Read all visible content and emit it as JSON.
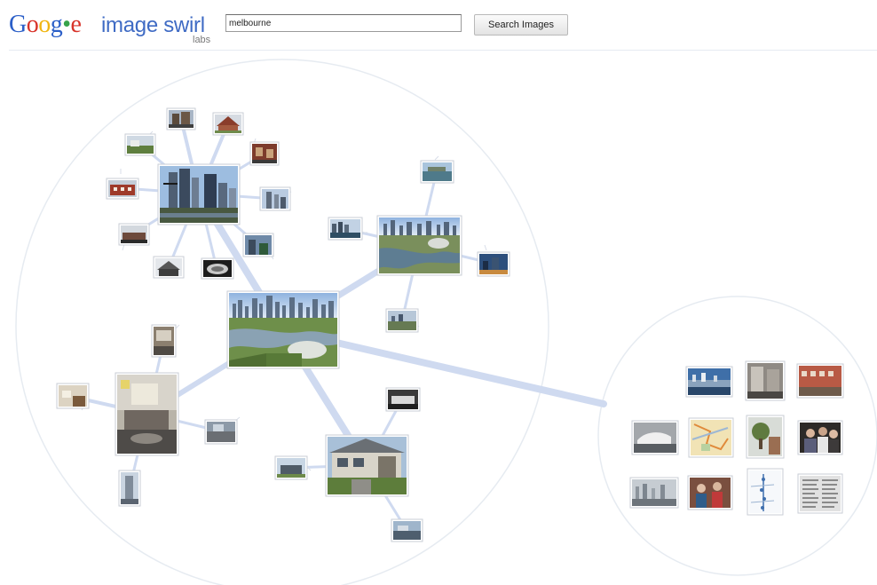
{
  "header": {
    "logo_letters": [
      {
        "ch": "G",
        "color": "#2b5fc8"
      },
      {
        "ch": "o",
        "color": "#d8332a"
      },
      {
        "ch": "o",
        "color": "#f0b613"
      },
      {
        "ch": "g",
        "color": "#2b5fc8"
      },
      {
        "ch": "•",
        "color": "#36a34a"
      },
      {
        "ch": "e",
        "color": "#d8332a"
      }
    ],
    "product_name": "image swirl",
    "labs_label": "labs",
    "search_value": "melbourne",
    "search_button_label": "Search Images"
  },
  "colors": {
    "link": "#cfdaf0",
    "circle": "#e3e8ef",
    "product": "#3f6bc4"
  },
  "clusters": [
    {
      "name": "main-cluster",
      "image": "melbourne-skyline-park-aerial"
    },
    {
      "name": "city-towers-cluster",
      "image": "melbourne-city-towers-river"
    },
    {
      "name": "city-aerial-cluster",
      "image": "melbourne-aerial-city"
    },
    {
      "name": "hotel-room-cluster",
      "image": "hotel-room-interior"
    },
    {
      "name": "house-cluster",
      "image": "suburban-house"
    }
  ],
  "secondary_group": {
    "name": "related-images-group",
    "images": [
      "harbour-panorama",
      "building-street",
      "red-brick-houses",
      "vehicle-on-road",
      "street-map",
      "tree-and-house",
      "group-photo",
      "city-haze",
      "people-at-event",
      "line-chart",
      "newspaper-clipping"
    ]
  }
}
